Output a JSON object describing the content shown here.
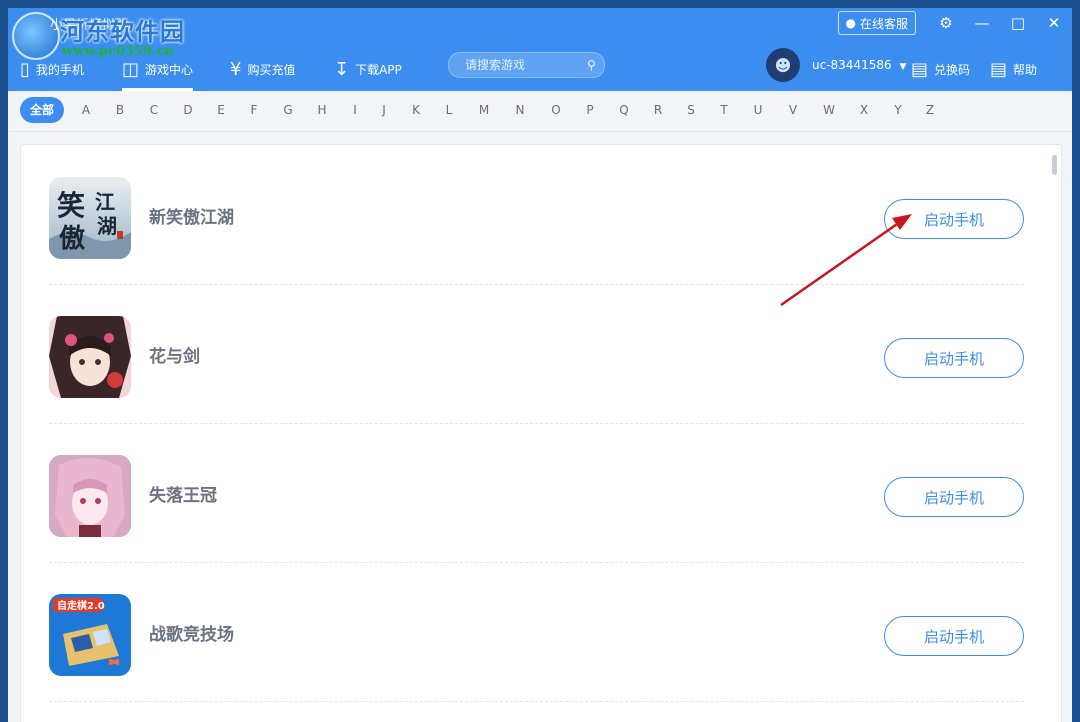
{
  "watermark": {
    "app_text": "小果折模拟器",
    "site_name": "河东软件园",
    "site_url": "www.pc0359.cn"
  },
  "window": {
    "service_label": "在线客服",
    "settings_icon": "gear-icon",
    "minimize_icon": "minimize-icon",
    "maximize_icon": "maximize-icon",
    "close_icon": "close-icon"
  },
  "nav": {
    "items": [
      {
        "label": "我的手机",
        "icon": "phone-icon"
      },
      {
        "label": "游戏中心",
        "icon": "gamepad-icon"
      },
      {
        "label": "购买充值",
        "icon": "yen-icon"
      },
      {
        "label": "下载APP",
        "icon": "download-icon"
      }
    ],
    "search_placeholder": "请搜索游戏",
    "username": "uc-83441586",
    "redeem_label": "兑换码",
    "help_label": "帮助"
  },
  "letters": {
    "all_label": "全部",
    "items": [
      "A",
      "B",
      "C",
      "D",
      "E",
      "F",
      "G",
      "H",
      "I",
      "J",
      "K",
      "L",
      "M",
      "N",
      "O",
      "P",
      "Q",
      "R",
      "S",
      "T",
      "U",
      "V",
      "W",
      "X",
      "Y",
      "Z"
    ]
  },
  "games": [
    {
      "name": "新笑傲江湖",
      "button": "启动手机"
    },
    {
      "name": "花与剑",
      "button": "启动手机"
    },
    {
      "name": "失落王冠",
      "button": "启动手机"
    },
    {
      "name": "战歌竞技场",
      "button": "启动手机"
    }
  ],
  "thumb_texts": {
    "xiaoao": "笑傲江湖",
    "zhange": "自走棋2.0"
  },
  "colors": {
    "accent": "#3b8ef0",
    "annotation_arrow": "#c8161d"
  }
}
